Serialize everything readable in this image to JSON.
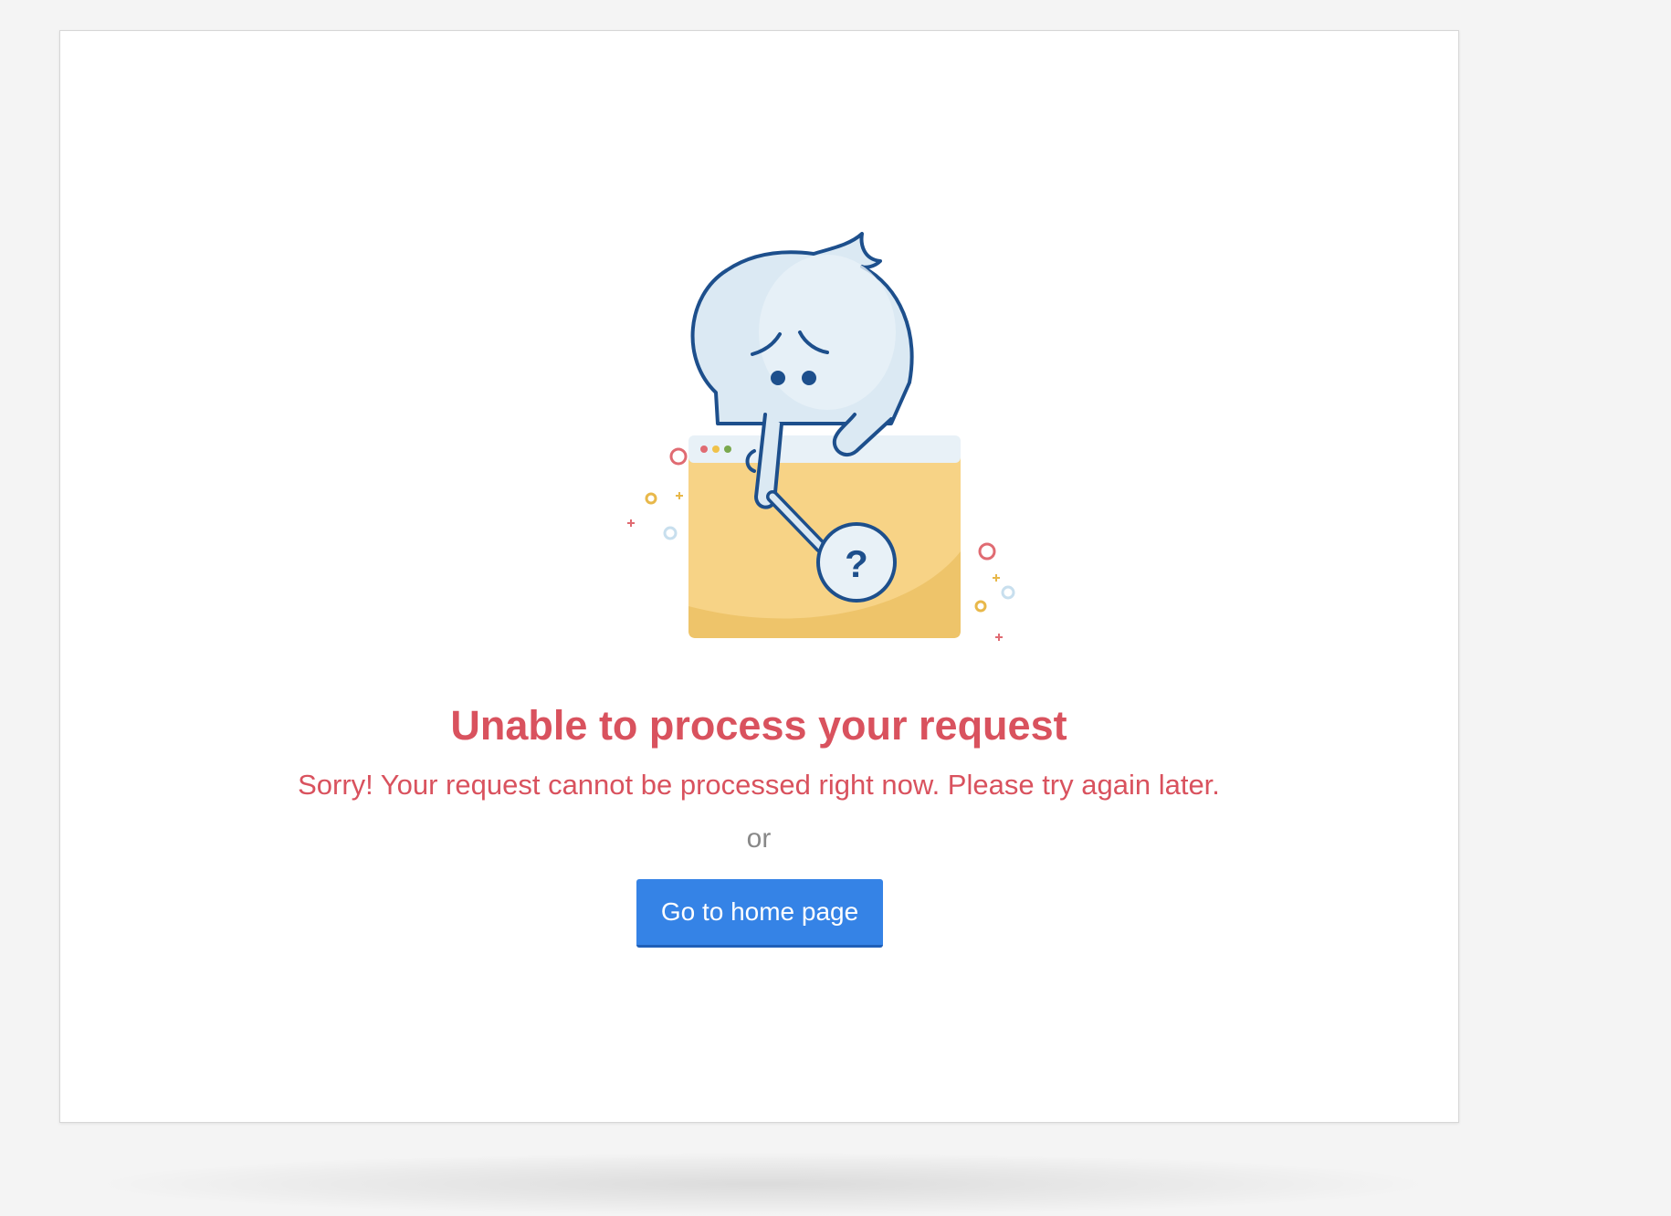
{
  "error": {
    "title": "Unable to process your request",
    "message": "Sorry! Your request cannot be processed right now. Please try again later.",
    "separator": "or",
    "button_label": "Go to home page"
  },
  "illustration": {
    "description_icon": "confused-character-with-magnifier-icon",
    "mark": "?"
  },
  "colors": {
    "title": "#d9525e",
    "message": "#d9525e",
    "separator": "#888888",
    "button": "#3583e6",
    "folder": "#f7d386",
    "character_outline": "#1d4f8c",
    "character_fill": "#dbe9f3"
  }
}
